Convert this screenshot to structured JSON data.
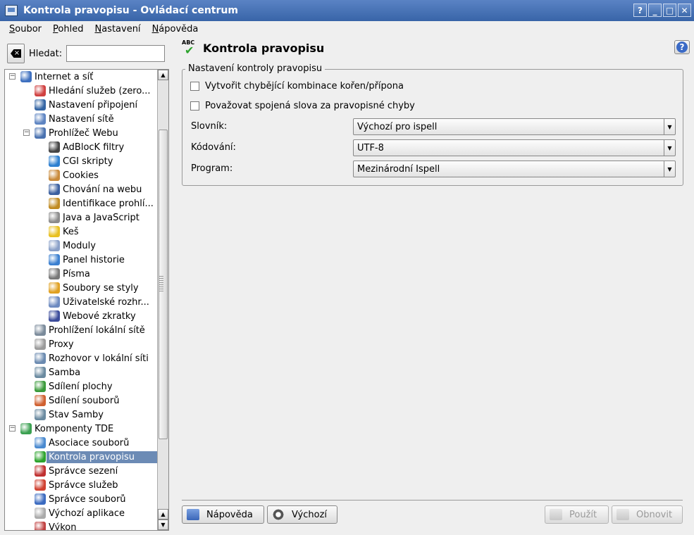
{
  "window": {
    "title": "Kontrola pravopisu - Ovládací centrum",
    "controls": [
      "?",
      "_",
      "□",
      "✕"
    ]
  },
  "menu": [
    "Soubor",
    "Pohled",
    "Nastavení",
    "Nápověda"
  ],
  "search": {
    "label": "Hledat:",
    "value": ""
  },
  "tree": {
    "items": [
      {
        "label": "Internet a síť",
        "level": 0,
        "expander": "minus",
        "icon_color": "#3d6fbf"
      },
      {
        "label": "Hledání služeb (zero...",
        "level": 1,
        "icon_color": "#d04040"
      },
      {
        "label": "Nastavení připojení",
        "level": 1,
        "icon_color": "#3465a4"
      },
      {
        "label": "Nastavení sítě",
        "level": 1,
        "icon_color": "#5d84c2"
      },
      {
        "label": "Prohlížeč Webu",
        "level": 1,
        "expander": "minus",
        "icon_color": "#4a72b0"
      },
      {
        "label": "AdBlocK filtry",
        "level": 2,
        "icon_color": "#444444"
      },
      {
        "label": "CGI skripty",
        "level": 2,
        "icon_color": "#2c7fd0"
      },
      {
        "label": "Cookies",
        "level": 2,
        "icon_color": "#c98a3a"
      },
      {
        "label": "Chování na webu",
        "level": 2,
        "icon_color": "#3a5f9f"
      },
      {
        "label": "Identifikace prohlí...",
        "level": 2,
        "icon_color": "#c08a20"
      },
      {
        "label": "Java a JavaScript",
        "level": 2,
        "icon_color": "#8b8b8b"
      },
      {
        "label": "Keš",
        "level": 2,
        "icon_color": "#e8c020"
      },
      {
        "label": "Moduly",
        "level": 2,
        "icon_color": "#8aa0c8"
      },
      {
        "label": "Panel historie",
        "level": 2,
        "icon_color": "#3a7fd0"
      },
      {
        "label": "Písma",
        "level": 2,
        "icon_color": "#777777"
      },
      {
        "label": "Soubory se styly",
        "level": 2,
        "icon_color": "#e0a020"
      },
      {
        "label": "Uživatelské rozhr...",
        "level": 2,
        "icon_color": "#6d8ac0"
      },
      {
        "label": "Webové zkratky",
        "level": 2,
        "icon_color": "#3a4a9a"
      },
      {
        "label": "Prohlížení lokální sítě",
        "level": 1,
        "icon_color": "#7a8a9a"
      },
      {
        "label": "Proxy",
        "level": 1,
        "icon_color": "#9a9a9a"
      },
      {
        "label": "Rozhovor v lokální síti",
        "level": 1,
        "icon_color": "#6a8ab0"
      },
      {
        "label": "Samba",
        "level": 1,
        "icon_color": "#6a8aa0"
      },
      {
        "label": "Sdílení plochy",
        "level": 1,
        "icon_color": "#3a9a3a"
      },
      {
        "label": "Sdílení souborů",
        "level": 1,
        "icon_color": "#d06030"
      },
      {
        "label": "Stav Samby",
        "level": 1,
        "icon_color": "#6a8aa0"
      },
      {
        "label": "Komponenty TDE",
        "level": 0,
        "expander": "minus",
        "icon_color": "#3aa050"
      },
      {
        "label": "Asociace souborů",
        "level": 1,
        "icon_color": "#4a8ad0"
      },
      {
        "label": "Kontrola pravopisu",
        "level": 1,
        "selected": true,
        "icon_color": "#2ca32c"
      },
      {
        "label": "Správce sezení",
        "level": 1,
        "icon_color": "#c03030"
      },
      {
        "label": "Správce služeb",
        "level": 1,
        "icon_color": "#d04030"
      },
      {
        "label": "Správce souborů",
        "level": 1,
        "icon_color": "#3a6ac0"
      },
      {
        "label": "Výchozí aplikace",
        "level": 1,
        "icon_color": "#aaaaaa"
      },
      {
        "label": "Výkon",
        "level": 1,
        "icon_color": "#c04040"
      }
    ]
  },
  "main": {
    "icon_text": "ABC",
    "title": "Kontrola pravopisu",
    "group_title": "Nastavení kontroly pravopisu",
    "checkboxes": [
      {
        "label": "Vytvořit chybějící kombinace kořen/přípona",
        "checked": false
      },
      {
        "label": "Považovat spojená slova za pravopisné chyby",
        "checked": false
      }
    ],
    "fields": [
      {
        "label": "Slovník:",
        "value": "Výchozí pro ispell"
      },
      {
        "label": "Kódování:",
        "value": "UTF-8"
      },
      {
        "label": "Program:",
        "value": "Mezinárodní Ispell"
      }
    ]
  },
  "buttons": {
    "help": "Nápověda",
    "defaults": "Výchozí",
    "apply": "Použít",
    "reset": "Obnovit"
  },
  "colors": {
    "titlebar": "#3864a8",
    "selection": "#6c8bb5",
    "accent_check": "#2ca32c"
  }
}
